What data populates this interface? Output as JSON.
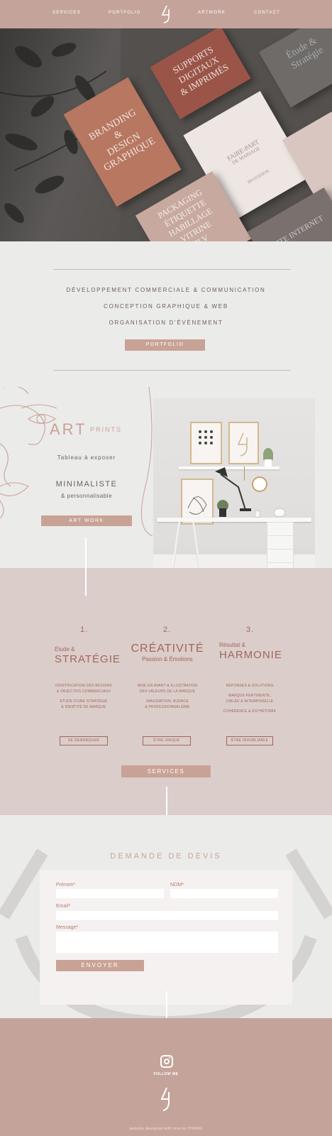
{
  "nav": {
    "links": [
      "SERVICES",
      "PORTFOLIO",
      "ARTWORK",
      "CONTACT"
    ]
  },
  "hero": {
    "cards": {
      "branding": [
        "BRANDING",
        "&",
        "DESIGN",
        "GRAPHIQUE"
      ],
      "supports": [
        "SUPPORTS",
        "DIGITAUX",
        "& IMPRIMÉS"
      ],
      "etude": [
        "Étude &",
        "Stratégie"
      ],
      "faire_part": [
        "FAIRE-PART",
        "DE MARIAGE"
      ],
      "invitation": [
        "INVITATION",
        "INVITATION"
      ],
      "packaging": [
        "PACKAGING",
        "ÉTIQUETTE",
        "HABILLAGE",
        "VITRINE",
        "PLV"
      ],
      "site": [
        "SITE INTERNET"
      ]
    }
  },
  "intro": {
    "lines": [
      "Développement commerciale & communication",
      "Conception graphique & web",
      "Organisation d'évènement"
    ],
    "button": "PORTFOLIO"
  },
  "art": {
    "title_art": "ART",
    "title_prints": "PRINTS",
    "subtitle": "Tableau à exposer",
    "minimal": "MINIMALISTE",
    "perso": "& personnalisable",
    "button": "ART WORK"
  },
  "process": {
    "columns": [
      {
        "num": "1.",
        "small": "Étude &",
        "big": "STRATÉGIE",
        "body1": [
          "IDENTIFICATION DES BESOINS",
          "& OBJECTIFS COMMERCIAUX"
        ],
        "body2": [
          "ÉTUDE D'UNE STRATÉGIE",
          "& IDENTITÉ DE MARQUE"
        ],
        "body3": [],
        "button": "SE DÉMARQUER"
      },
      {
        "num": "2.",
        "small": "Passion & Émotions",
        "big": "CRÉATIVITÉ",
        "body1": [
          "MISE EN AVANT & ILLUSTRATION",
          "DES VALEURS DE LA MARQUE"
        ],
        "body2": [
          "IMAGINATION, AUDACE",
          "& PROFESSIONNALISME"
        ],
        "body3": [],
        "button": "ÊTRE UNIQUE"
      },
      {
        "num": "3.",
        "small": "Résultat &",
        "big": "HARMONIE",
        "body1": [
          "RÉPONSES & SOLUTIONS"
        ],
        "body2": [
          "MARQUE PERTINENTE,",
          "CIBLÉE & INTEMPORELLE"
        ],
        "body3": [
          "COHÉRENCE & ESTHÉTISME"
        ],
        "button": "ÊTRE INOUBLIABLE"
      }
    ],
    "button": "SERVICES"
  },
  "devis": {
    "title": "DEMANDE DE DEVIS",
    "prenom": "Prénom*",
    "nom": "NOM*",
    "email": "Email*",
    "message": "Message*",
    "button": "ENVOYER"
  },
  "footer": {
    "follow": "FOLLOW ME",
    "credit": "website designed with love by HYANG"
  },
  "colors": {
    "nav": "#c4a49a",
    "accent": "#c9a296",
    "terracotta": "#a1665c",
    "process_bg": "#dbcdca",
    "page_bg": "#ebebea"
  },
  "icons": [
    "logo-mark-icon",
    "instagram-icon"
  ]
}
